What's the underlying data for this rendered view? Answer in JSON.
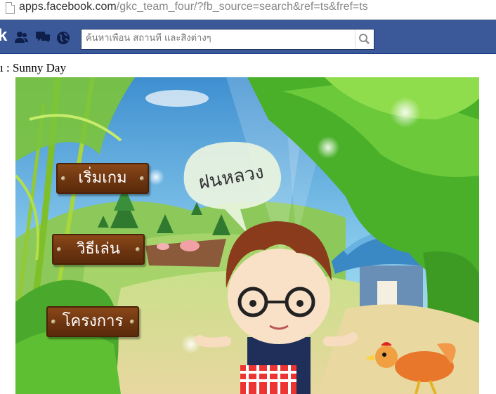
{
  "browser": {
    "url_host": "apps.facebook.com",
    "url_path": "/gkc_team_four/?fb_source=search&ref=ts&fref=ts"
  },
  "facebook_bar": {
    "logo": "k",
    "search_placeholder": "ค้นหาเพื่อน สถานที่ และสิ่งต่างๆ",
    "icons": [
      "friends-icon",
      "messages-icon",
      "notifications-globe-icon",
      "search-icon"
    ]
  },
  "app": {
    "title": "ı : Sunny Day"
  },
  "game": {
    "speech_bubble": "ฝนหลวง",
    "menu": {
      "start": "เริ่มเกม",
      "how_to_play": "วิธีเล่น",
      "project": "โครงการ"
    }
  },
  "colors": {
    "facebook_blue": "#3b5998",
    "button_wood": "#7a3d12",
    "sky": "#6fb6e4",
    "foliage": "#5cbf2a"
  }
}
